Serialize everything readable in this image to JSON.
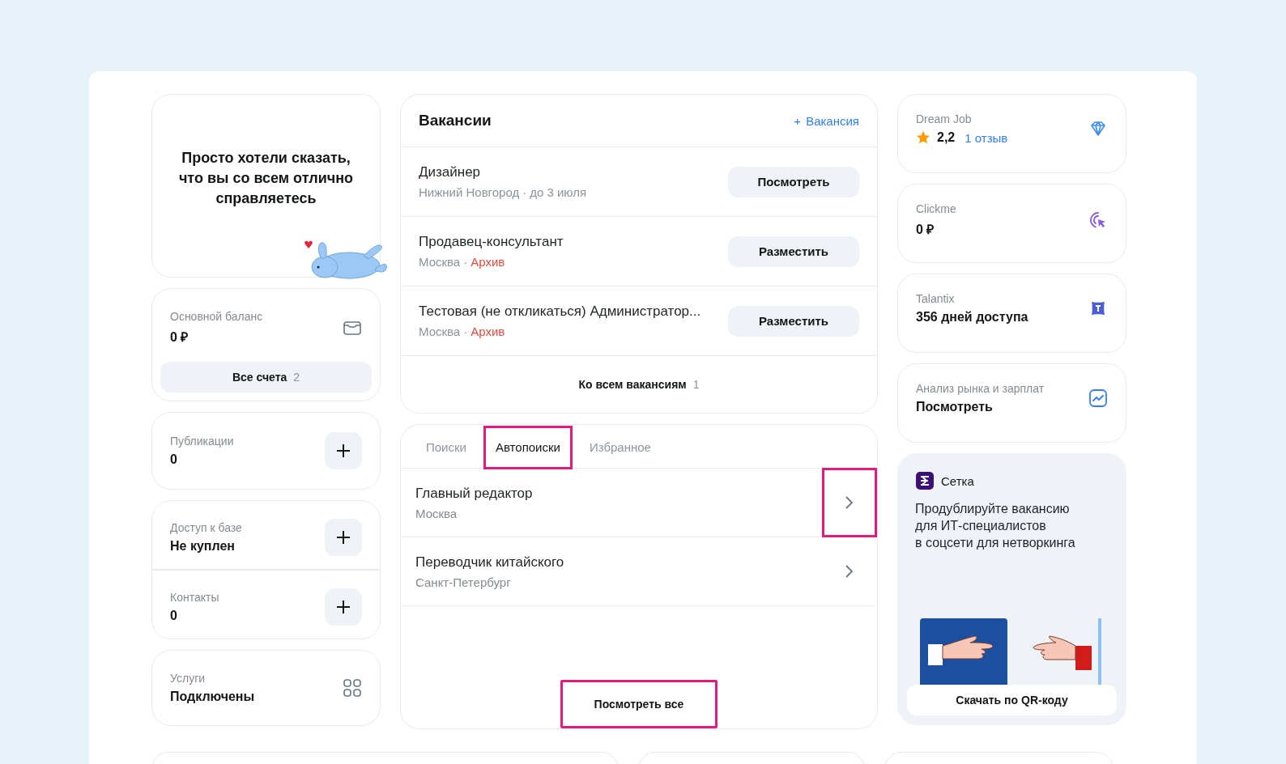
{
  "motivation": {
    "text": "Просто хотели сказать, что вы со всем отлично справляетесь"
  },
  "balance": {
    "label": "Основной баланс",
    "value": "0 ₽",
    "button_label": "Все счета",
    "button_count": "2"
  },
  "publications": {
    "label": "Публикации",
    "value": "0"
  },
  "access": [
    {
      "label": "Доступ к базе",
      "value": "Не куплен"
    },
    {
      "label": "Контакты",
      "value": "0"
    }
  ],
  "services": {
    "label": "Услуги",
    "value": "Подключены"
  },
  "vacancies": {
    "title": "Вакансии",
    "add_icon": "+",
    "add_label": "Вакансия",
    "items": [
      {
        "title": "Дизайнер",
        "location": "Нижний Новгород",
        "separator": "·",
        "status": "до 3 июля",
        "archived": false,
        "action": "Посмотреть"
      },
      {
        "title": "Продавец-консультант",
        "location": "Москва",
        "separator": "·",
        "status": "Архив",
        "archived": true,
        "action": "Разместить"
      },
      {
        "title": "Тестовая (не откликаться) Администратор...",
        "location": "Москва",
        "separator": "·",
        "status": "Архив",
        "archived": true,
        "action": "Разместить"
      }
    ],
    "footer_label": "Ко всем вакансиям",
    "footer_count": "1"
  },
  "autosearch": {
    "tabs": [
      {
        "label": "Поиски",
        "selected": false,
        "highlighted": false
      },
      {
        "label": "Автопоиски",
        "selected": true,
        "highlighted": true
      },
      {
        "label": "Избранное",
        "selected": false,
        "highlighted": false
      }
    ],
    "items": [
      {
        "title": "Главный редактор",
        "location": "Москва",
        "highlighted": true
      },
      {
        "title": "Переводчик китайского",
        "location": "Санкт-Петербург",
        "highlighted": false
      }
    ],
    "view_all": {
      "label": "Посмотреть все",
      "highlighted": true
    }
  },
  "partners": [
    {
      "kind": "rating",
      "name": "Dream Job",
      "rating": "2,2",
      "reviews": "1 отзыв"
    },
    {
      "kind": "clickme",
      "name": "Clickme",
      "value": "0 ₽"
    },
    {
      "kind": "talantix",
      "name": "Talantix",
      "value": "356 дней доступа"
    },
    {
      "kind": "analytics",
      "name": "Анализ рынка и зарплат",
      "value": "Посмотреть"
    }
  ],
  "setka": {
    "brand": "Сетка",
    "text": "Продублируйте вакансию\nдля ИТ-специалистов\nв соцсети для нетворкинга",
    "button": "Скачать по QR-коду"
  }
}
